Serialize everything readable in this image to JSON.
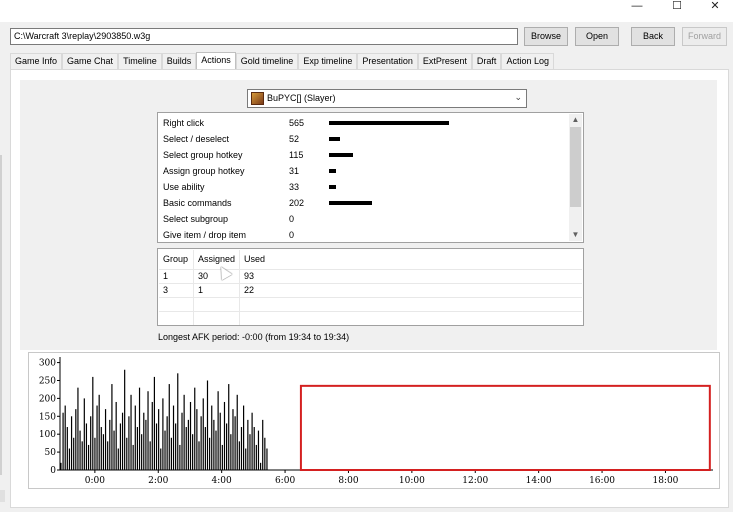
{
  "window": {
    "minimize_glyph": "—",
    "maximize_glyph": "☐",
    "close_glyph": "✕"
  },
  "toolbar": {
    "path_value": "C:\\Warcraft 3\\replay\\2903850.w3g",
    "browse_label": "Browse",
    "open_label": "Open",
    "back_label": "Back",
    "forward_label": "Forward"
  },
  "tabs": [
    {
      "label": "Game Info"
    },
    {
      "label": "Game Chat"
    },
    {
      "label": "Timeline"
    },
    {
      "label": "Builds"
    },
    {
      "label": "Actions",
      "active": true
    },
    {
      "label": "Gold timeline"
    },
    {
      "label": "Exp timeline"
    },
    {
      "label": "Presentation"
    },
    {
      "label": "ExtPresent"
    },
    {
      "label": "Draft"
    },
    {
      "label": "Action Log"
    }
  ],
  "player_select": {
    "selected": "BuPYC[] (Slayer)",
    "icon": "player-portrait-icon"
  },
  "actions": [
    {
      "name": "Right click",
      "value": 565
    },
    {
      "name": "Select / deselect",
      "value": 52
    },
    {
      "name": "Select group hotkey",
      "value": 115
    },
    {
      "name": "Assign group hotkey",
      "value": 31
    },
    {
      "name": "Use ability",
      "value": 33
    },
    {
      "name": "Basic commands",
      "value": 202
    },
    {
      "name": "Select subgroup",
      "value": 0
    },
    {
      "name": "Give item / drop item",
      "value": 0
    }
  ],
  "groups": {
    "headers": [
      "Group",
      "Assigned",
      "Used"
    ],
    "rows": [
      [
        "1",
        "30",
        "93"
      ],
      [
        "3",
        "1",
        "22"
      ]
    ]
  },
  "afk_text": "Longest AFK period: -0:00 (from 19:34 to 19:34)",
  "chart_data": {
    "type": "bar",
    "title": "",
    "xlabel": "",
    "ylabel": "",
    "yticks": [
      "300",
      "250",
      "200",
      "150",
      "100",
      "50",
      "0"
    ],
    "xticks": [
      "0:00",
      "2:00",
      "4:00",
      "6:00",
      "8:00",
      "10:00",
      "12:00",
      "14:00",
      "16:00",
      "18:00"
    ],
    "ylim": [
      0,
      310
    ],
    "xlim_minutes": [
      -1.1,
      19.5
    ],
    "bar_spacing_minutes": 0.067,
    "x_start_minutes": -1.07,
    "values": [
      20,
      160,
      180,
      120,
      60,
      150,
      90,
      170,
      230,
      110,
      80,
      200,
      130,
      70,
      150,
      260,
      90,
      180,
      210,
      120,
      100,
      170,
      80,
      140,
      240,
      110,
      190,
      60,
      130,
      160,
      280,
      90,
      150,
      210,
      70,
      180,
      120,
      230,
      100,
      160,
      140,
      220,
      80,
      190,
      260,
      130,
      170,
      60,
      200,
      110,
      150,
      240,
      90,
      180,
      130,
      270,
      70,
      160,
      210,
      120,
      140,
      190,
      100,
      230,
      170,
      80,
      150,
      200,
      120,
      250,
      90,
      180,
      140,
      110,
      220,
      160,
      70,
      190,
      130,
      240,
      100,
      170,
      150,
      210,
      80,
      120,
      180,
      60,
      140,
      100,
      160,
      120,
      70,
      110,
      20,
      140,
      90,
      60
    ],
    "highlight_range_minutes": [
      6.5,
      19.4
    ],
    "highlight_color": "#d42020"
  }
}
